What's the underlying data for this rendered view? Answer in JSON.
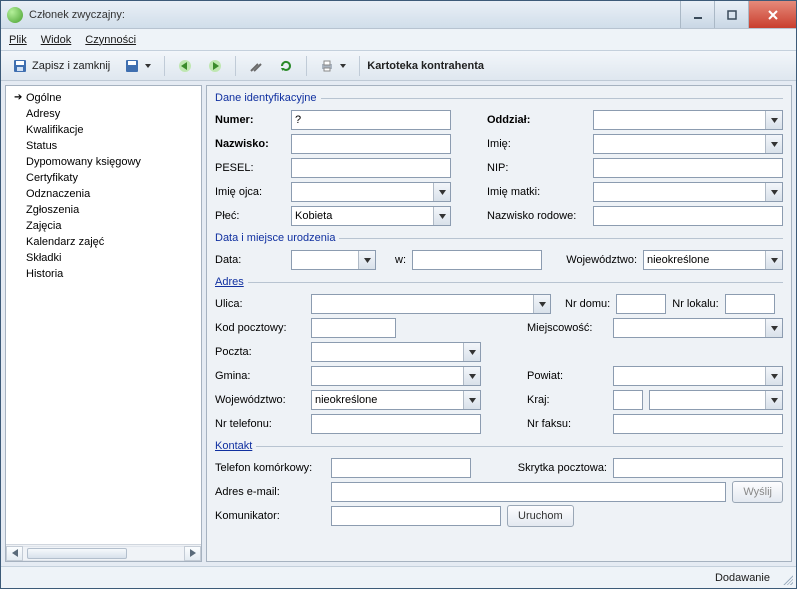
{
  "window": {
    "title": "Członek zwyczajny:"
  },
  "menu": {
    "file": "Plik",
    "view": "Widok",
    "actions": "Czynności"
  },
  "toolbar": {
    "save_close": "Zapisz i zamknij",
    "caption": "Kartoteka kontrahenta"
  },
  "nav": {
    "items": [
      "Ogólne",
      "Adresy",
      "Kwalifikacje",
      "Status",
      "Dypomowany księgowy",
      "Certyfikaty",
      "Odznaczenia",
      "Zgłoszenia",
      "Zajęcia",
      "Kalendarz zajęć",
      "Składki",
      "Historia"
    ],
    "selected": 0
  },
  "groups": {
    "ident": "Dane identyfikacyjne",
    "birth": "Data i miejsce urodzenia",
    "address": "Adres",
    "contact": "Kontakt"
  },
  "labels": {
    "numer": "Numer:",
    "oddzial": "Oddział:",
    "nazwisko": "Nazwisko:",
    "imie": "Imię:",
    "pesel": "PESEL:",
    "nip": "NIP:",
    "imie_ojca": "Imię ojca:",
    "imie_matki": "Imię matki:",
    "plec": "Płeć:",
    "nazwisko_rodowe": "Nazwisko rodowe:",
    "data": "Data:",
    "w": "w:",
    "wojewodztwo": "Województwo:",
    "ulica": "Ulica:",
    "nr_domu": "Nr domu:",
    "nr_lokalu": "Nr lokalu:",
    "kod_pocztowy": "Kod pocztowy:",
    "miejscowosc": "Miejscowość:",
    "poczta": "Poczta:",
    "gmina": "Gmina:",
    "powiat": "Powiat:",
    "kraj": "Kraj:",
    "nr_telefonu": "Nr telefonu:",
    "nr_faksu": "Nr faksu:",
    "telefon_kom": "Telefon komórkowy:",
    "skrytka": "Skrytka pocztowa:",
    "email": "Adres e-mail:",
    "wyslij": "Wyślij",
    "komunikator": "Komunikator:",
    "uruchom": "Uruchom"
  },
  "values": {
    "numer": "?",
    "oddzial": "",
    "nazwisko": "",
    "imie": "",
    "pesel": "",
    "nip": "",
    "imie_ojca": "",
    "imie_matki": "",
    "plec": "Kobieta",
    "nazwisko_rodowe": "",
    "data": "",
    "miejsce": "",
    "wojewodztwo_ur": "nieokreślone",
    "ulica": "",
    "nr_domu": "",
    "nr_lokalu": "",
    "kod_pocztowy": "",
    "miejscowosc": "",
    "poczta": "",
    "gmina": "",
    "powiat": "",
    "wojewodztwo_adr": "nieokreślone",
    "kraj_code": "",
    "kraj": "",
    "nr_telefonu": "",
    "nr_faksu": "",
    "telefon_kom": "",
    "skrytka": "",
    "email": "",
    "komunikator": ""
  },
  "status": {
    "text": "Dodawanie"
  }
}
